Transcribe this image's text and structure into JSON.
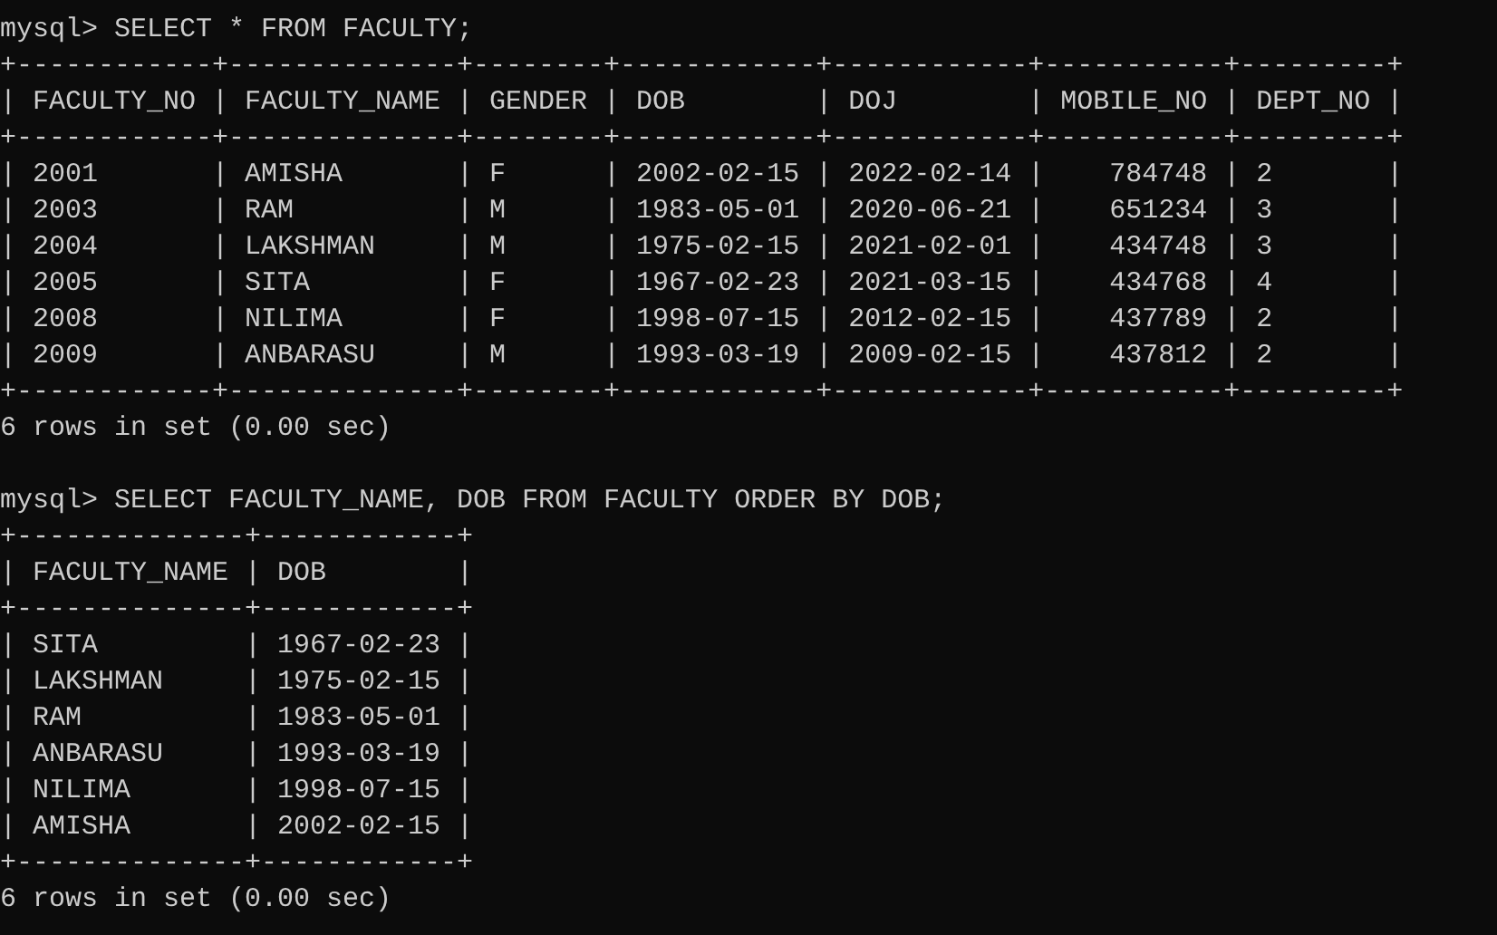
{
  "queries": [
    {
      "command": "mysql> SELECT * FROM FACULTY;",
      "table": [
        "+------------+--------------+--------+------------+------------+-----------+---------+",
        "| FACULTY_NO | FACULTY_NAME | GENDER | DOB        | DOJ        | MOBILE_NO | DEPT_NO |",
        "+------------+--------------+--------+------------+------------+-----------+---------+",
        "| 2001       | AMISHA       | F      | 2002-02-15 | 2022-02-14 |    784748 | 2       |",
        "| 2003       | RAM          | M      | 1983-05-01 | 2020-06-21 |    651234 | 3       |",
        "| 2004       | LAKSHMAN     | M      | 1975-02-15 | 2021-02-01 |    434748 | 3       |",
        "| 2005       | SITA         | F      | 1967-02-23 | 2021-03-15 |    434768 | 4       |",
        "| 2008       | NILIMA       | F      | 1998-07-15 | 2012-02-15 |    437789 | 2       |",
        "| 2009       | ANBARASU     | M      | 1993-03-19 | 2009-02-15 |    437812 | 2       |",
        "+------------+--------------+--------+------------+------------+-----------+---------+"
      ],
      "summary": "6 rows in set (0.00 sec)"
    },
    {
      "command": "mysql> SELECT FACULTY_NAME, DOB FROM FACULTY ORDER BY DOB;",
      "table": [
        "+--------------+------------+",
        "| FACULTY_NAME | DOB        |",
        "+--------------+------------+",
        "| SITA         | 1967-02-23 |",
        "| LAKSHMAN     | 1975-02-15 |",
        "| RAM          | 1983-05-01 |",
        "| ANBARASU     | 1993-03-19 |",
        "| NILIMA       | 1998-07-15 |",
        "| AMISHA       | 2002-02-15 |",
        "+--------------+------------+"
      ],
      "summary": "6 rows in set (0.00 sec)"
    }
  ]
}
